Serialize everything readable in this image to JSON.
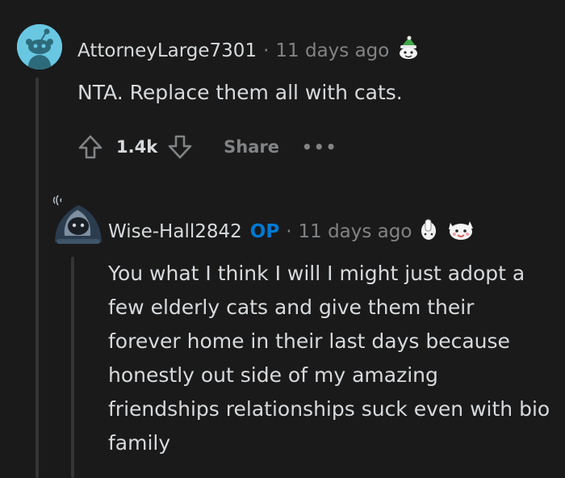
{
  "comment": {
    "author": "AttorneyLarge7301",
    "separator": "·",
    "time": "11 days ago",
    "body": "NTA. Replace them all with cats.",
    "score": "1.4k",
    "share_label": "Share",
    "more_label": "•••"
  },
  "reply": {
    "author": "Wise-Hall2842",
    "op_badge": "OP",
    "separator": "·",
    "time": "11 days ago",
    "body": "You what I think I will I might just adopt a few elderly cats and give them their forever home in their last days because honestly out side of my amazing friendships relationships suck even with bio family"
  },
  "colors": {
    "background": "#1a1a1b",
    "text": "#d7dadc",
    "muted": "#818384",
    "op_blue": "#0079d3",
    "avatar_bg": "#69c7e2"
  }
}
